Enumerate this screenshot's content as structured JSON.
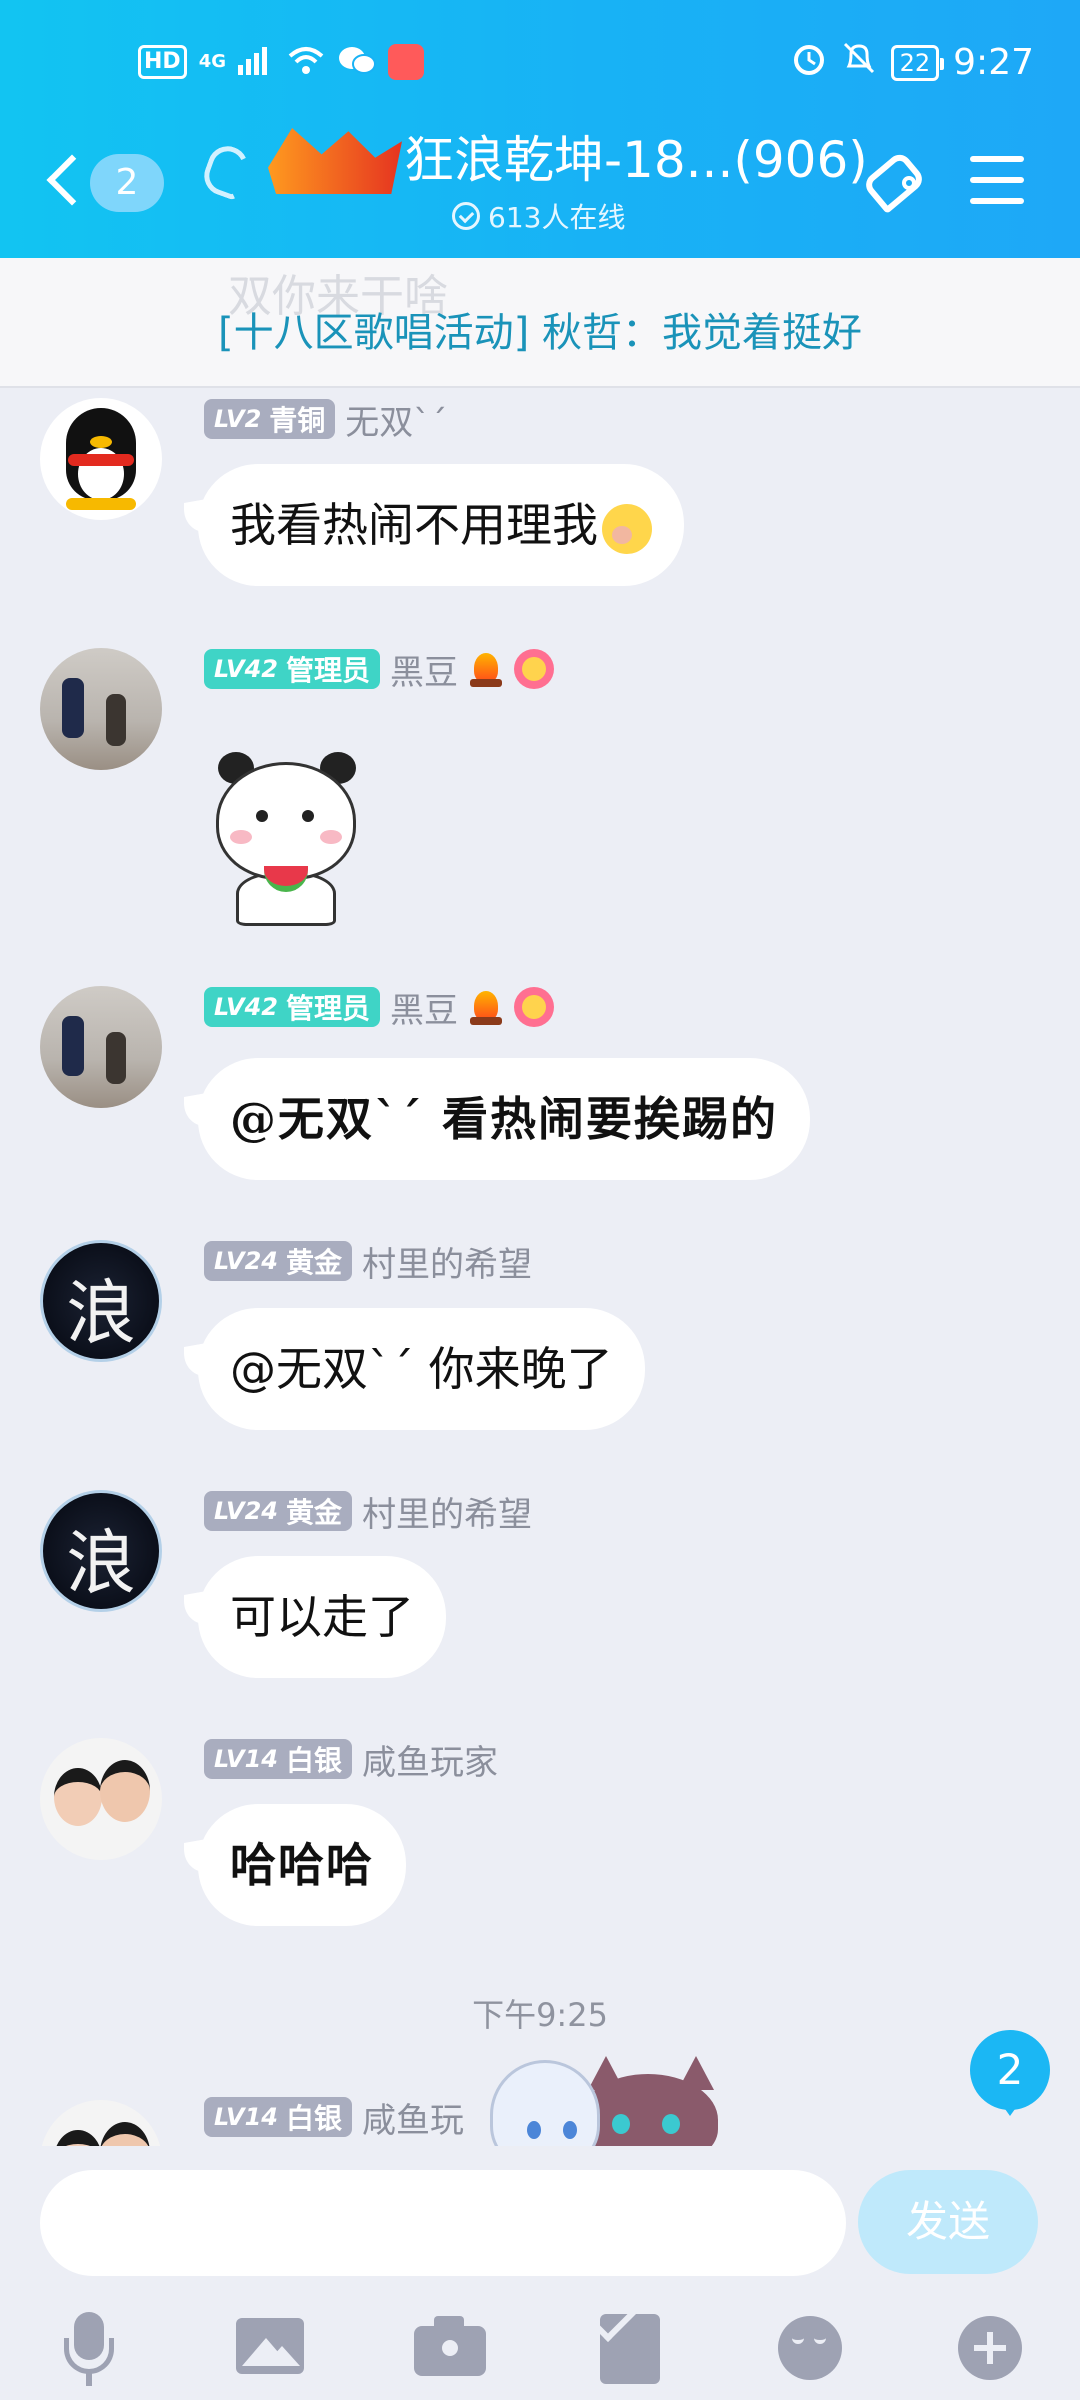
{
  "status_bar": {
    "hd": "HD",
    "network": "4G",
    "battery": "22",
    "time": "9:27"
  },
  "header": {
    "unread_count": "2",
    "group_title": "狂浪乾坤-18...(906)",
    "online_text": "613人在线"
  },
  "announcement": {
    "ghost_text": "双你来干啥",
    "text": "[十八区歌唱活动] 秋哲：我觉着挺好"
  },
  "messages": [
    {
      "level": "LV2",
      "title": "青铜",
      "badge_color": "#a9adbf",
      "nick": "无双ˋˊ",
      "text": "我看热闹不用理我",
      "avatar": "qq-penguin"
    },
    {
      "level": "LV42",
      "title": "管理员",
      "badge_color": "#3fd4c6",
      "nick": "黑豆",
      "sticker": "panda-watermelon",
      "avatar": "room-photo"
    },
    {
      "level": "LV42",
      "title": "管理员",
      "badge_color": "#3fd4c6",
      "nick": "黑豆",
      "text": "@无双ˋˊ 看热闹要挨踢的",
      "avatar": "room-photo"
    },
    {
      "level": "LV24",
      "title": "黄金",
      "badge_color": "#a9adbf",
      "nick": "村里的希望",
      "text": "@无双ˋˊ 你来晚了",
      "avatar": "lang-char",
      "avatar_char": "浪"
    },
    {
      "level": "LV24",
      "title": "黄金",
      "badge_color": "#a9adbf",
      "nick": "村里的希望",
      "text": "可以走了",
      "avatar": "lang-char",
      "avatar_char": "浪"
    },
    {
      "level": "LV14",
      "title": "白银",
      "badge_color": "#a9adbf",
      "nick": "咸鱼玩家",
      "text": "哈哈哈",
      "avatar": "couple-photo"
    }
  ],
  "time_divider": "下午9:25",
  "partial_message": {
    "level": "LV14",
    "title": "白银",
    "nick": "咸鱼玩"
  },
  "new_message_badge": "2",
  "input": {
    "placeholder": "",
    "send_label": "发送"
  },
  "toolbar": [
    "microphone-icon",
    "image-icon",
    "camera-icon",
    "red-packet-icon",
    "emoji-icon",
    "plus-icon"
  ]
}
